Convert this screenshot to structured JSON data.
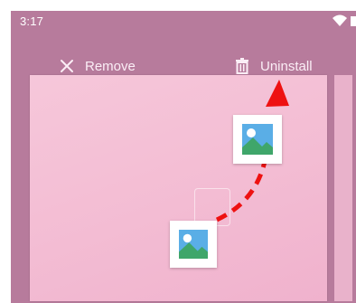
{
  "status_bar": {
    "time": "3:17",
    "icons": [
      "wifi-icon",
      "battery-icon"
    ]
  },
  "drop_bar": {
    "remove_label": "Remove",
    "remove_icon": "close-icon",
    "uninstall_label": "Uninstall",
    "uninstall_icon": "trash-icon"
  },
  "drag": {
    "app_icon": "image-gallery-icon",
    "arrow_color": "#ee1111",
    "wallpaper_color": "#b77b9c",
    "page_color": "#f4c0d6"
  }
}
